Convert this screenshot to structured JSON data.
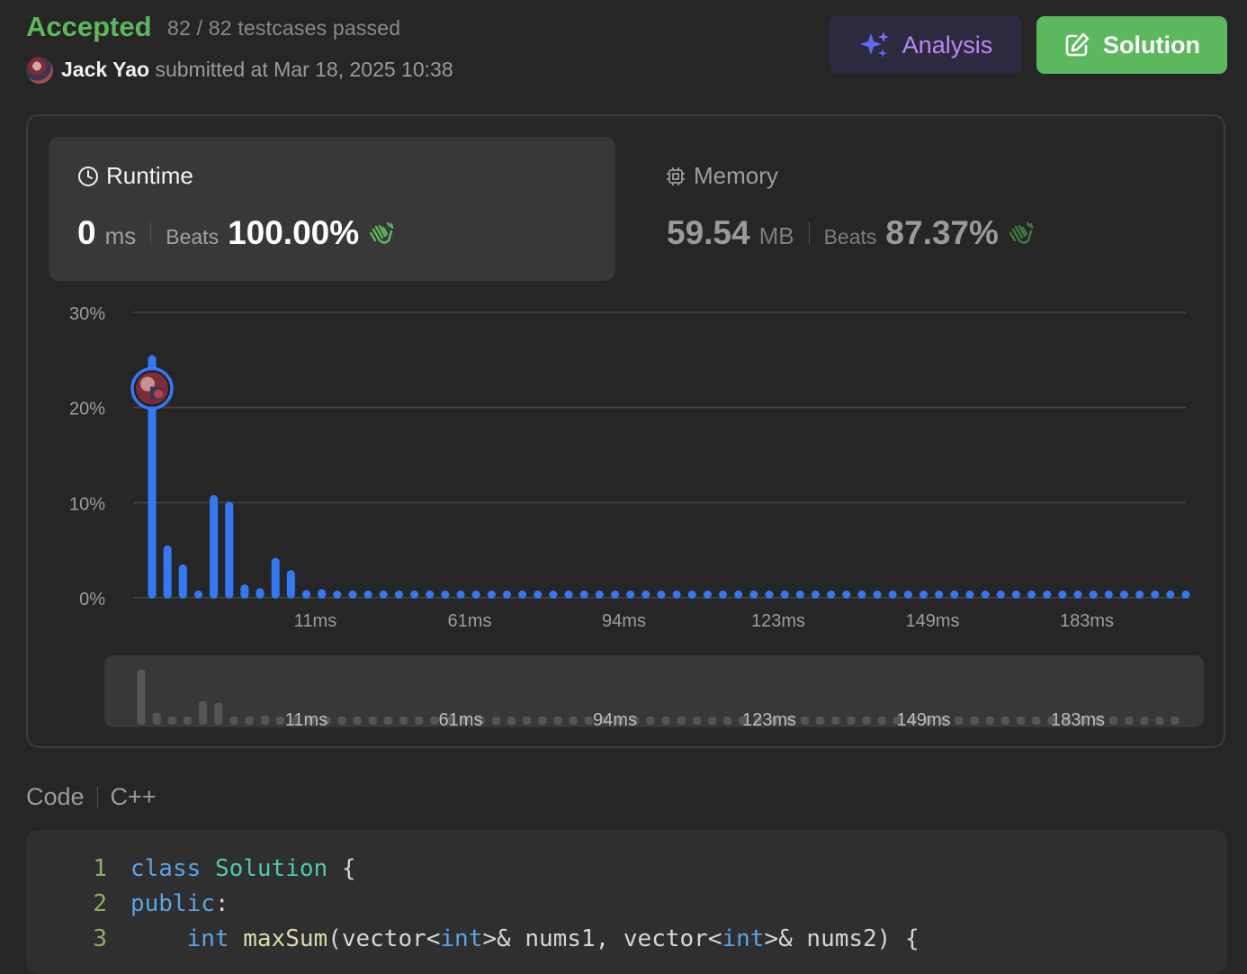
{
  "header": {
    "status": "Accepted",
    "testcases": "82 / 82 testcases passed",
    "user_name": "Jack Yao",
    "submitted_text": "submitted at Mar 18, 2025 10:38"
  },
  "buttons": {
    "analysis": "Analysis",
    "solution": "Solution"
  },
  "runtime": {
    "title": "Runtime",
    "value": "0",
    "unit": "ms",
    "beats_label": "Beats",
    "beats_value": "100.00%"
  },
  "memory": {
    "title": "Memory",
    "value": "59.54",
    "unit": "MB",
    "beats_label": "Beats",
    "beats_value": "87.37%"
  },
  "colors": {
    "accepted": "#5cb85c",
    "bar_blue": "#3478f6",
    "analysis_purple": "#b78bf4",
    "solution_green": "#5cb85c",
    "mini_bar_gray": "#555555"
  },
  "chart_data": {
    "type": "bar",
    "title": "",
    "xlabel": "",
    "ylabel": "",
    "ylim": [
      0,
      30
    ],
    "y_ticks": [
      "30%",
      "20%",
      "10%",
      "0%"
    ],
    "x_tick_labels": [
      "11ms",
      "61ms",
      "94ms",
      "123ms",
      "149ms",
      "183ms"
    ],
    "x_tick_bar_index": [
      10,
      20,
      30,
      40,
      50,
      60
    ],
    "grid": true,
    "highlighted_bar_index": 0,
    "highlight_value": 22,
    "values": [
      25.5,
      5.5,
      3.5,
      0.5,
      10.8,
      10.1,
      1.4,
      1.0,
      4.2,
      2.9,
      0.8,
      0.9,
      0.7,
      0.7,
      0.7,
      0.7,
      0.7,
      0.7,
      0.7,
      0.7,
      0.7,
      0.7,
      0.7,
      0.7,
      0.7,
      0.7,
      0.7,
      0.7,
      0.7,
      0.7,
      0.7,
      0.7,
      0.7,
      0.7,
      0.7,
      0.7,
      0.7,
      0.7,
      0.7,
      0.7,
      0.7,
      0.7,
      0.7,
      0.7,
      0.7,
      0.7,
      0.7,
      0.7,
      0.7,
      0.7,
      0.7,
      0.7,
      0.7,
      0.7,
      0.7,
      0.7,
      0.7,
      0.7,
      0.7,
      0.7,
      0.7,
      0.7,
      0.7,
      0.7,
      0.7,
      0.7,
      0.7,
      0.7
    ]
  },
  "code": {
    "label": "Code",
    "language": "C++",
    "lines": [
      {
        "number": "1",
        "parts": [
          {
            "t": "class",
            "c": "kw"
          },
          {
            "t": " ",
            "c": ""
          },
          {
            "t": "Solution",
            "c": "ty"
          },
          {
            "t": " {",
            "c": ""
          }
        ]
      },
      {
        "number": "2",
        "parts": [
          {
            "t": "public",
            "c": "kw"
          },
          {
            "t": ":",
            "c": ""
          }
        ]
      },
      {
        "number": "3",
        "parts": [
          {
            "t": "    ",
            "c": ""
          },
          {
            "t": "int",
            "c": "kw"
          },
          {
            "t": " ",
            "c": ""
          },
          {
            "t": "maxSum",
            "c": "fn"
          },
          {
            "t": "(vector<",
            "c": ""
          },
          {
            "t": "int",
            "c": "kw"
          },
          {
            "t": ">& nums1, vector<",
            "c": ""
          },
          {
            "t": "int",
            "c": "kw"
          },
          {
            "t": ">& nums2) {",
            "c": ""
          }
        ]
      }
    ]
  }
}
